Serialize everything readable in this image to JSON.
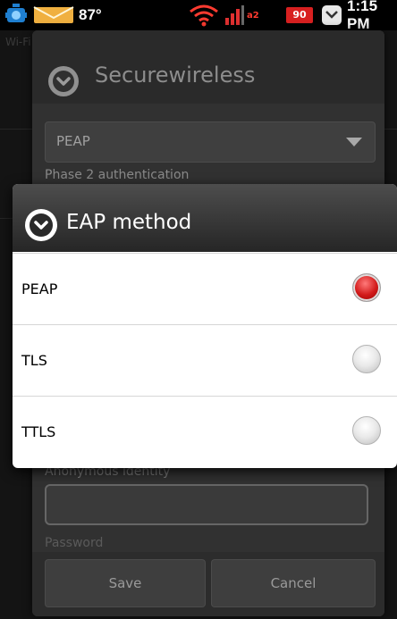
{
  "status_bar": {
    "temperature": "87°",
    "signal_badge": "a2",
    "battery_badge": "90",
    "time": "1:15 PM"
  },
  "background_page": {
    "title": "Wi-Fi settings"
  },
  "network_dialog": {
    "title": "Securewireless",
    "eap_value": "PEAP",
    "phase2_label": "Phase 2 authentication",
    "anonymous_identity_label": "Anonymous identity",
    "password_label": "Password",
    "save_label": "Save",
    "cancel_label": "Cancel"
  },
  "eap_dialog": {
    "title": "EAP method",
    "options": [
      {
        "label": "PEAP",
        "selected": true
      },
      {
        "label": "TLS",
        "selected": false
      },
      {
        "label": "TTLS",
        "selected": false
      }
    ]
  },
  "icons": {
    "notification": "android-notification-icon",
    "mail": "envelope-icon",
    "wifi": "wifi-icon",
    "signal": "signal-icon",
    "battery": "battery-icon",
    "message": "message-icon",
    "dialog": "chevron-circle-icon"
  },
  "colors": {
    "selected_radio": "#d21a1a",
    "dialog_header": "#2a2a2a",
    "list_background": "#ffffff"
  }
}
